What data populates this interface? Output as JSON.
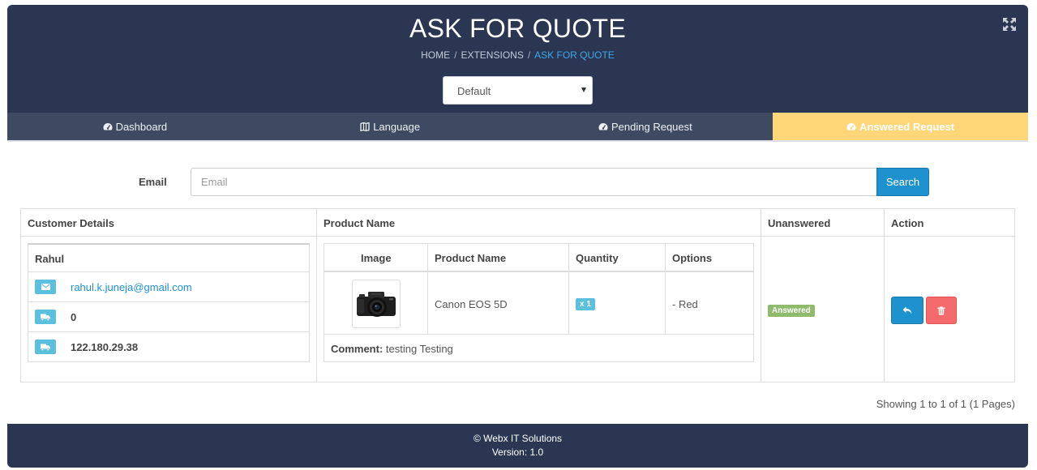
{
  "header": {
    "title": "ASK FOR QUOTE",
    "breadcrumb": [
      "HOME",
      "EXTENSIONS",
      "ASK FOR QUOTE"
    ],
    "store_select": {
      "selected": "Default"
    }
  },
  "tabs": [
    {
      "label": "Dashboard",
      "icon": "dashboard-icon",
      "active": false
    },
    {
      "label": "Language",
      "icon": "language-icon",
      "active": false
    },
    {
      "label": "Pending Request",
      "icon": "dashboard-icon",
      "active": false
    },
    {
      "label": "Answered Request",
      "icon": "dashboard-icon",
      "active": true
    }
  ],
  "filter": {
    "email_label": "Email",
    "email_placeholder": "Email",
    "email_value": "",
    "search_label": "Search"
  },
  "table": {
    "columns": [
      "Customer Details",
      "Product Name",
      "Unanswered",
      "Action"
    ],
    "rows": [
      {
        "customer": {
          "name": "Rahul",
          "email": "rahul.k.juneja@gmail.com",
          "telephone": "0",
          "ip": "122.180.29.38"
        },
        "products": {
          "columns": [
            "Image",
            "Product Name",
            "Quantity",
            "Options"
          ],
          "items": [
            {
              "image": "camera-image",
              "name": "Canon EOS 5D",
              "quantity": "x 1",
              "options": "- Red"
            }
          ],
          "comment_label": "Comment:",
          "comment": "testing Testing"
        },
        "status": "Answered",
        "actions": [
          "reply",
          "delete"
        ]
      }
    ]
  },
  "pagination": {
    "info": "Showing 1 to 1 of 1 (1 Pages)"
  },
  "footer": {
    "copyright": "© Webx IT Solutions",
    "version": "Version: 1.0"
  },
  "colors": {
    "header_bg": "#2b3752",
    "tab_bg": "#3d4a62",
    "active_tab": "#ffd678",
    "primary": "#1e91cf",
    "info": "#5bc0de",
    "success": "#8fbb6c",
    "danger": "#f56b6b"
  }
}
